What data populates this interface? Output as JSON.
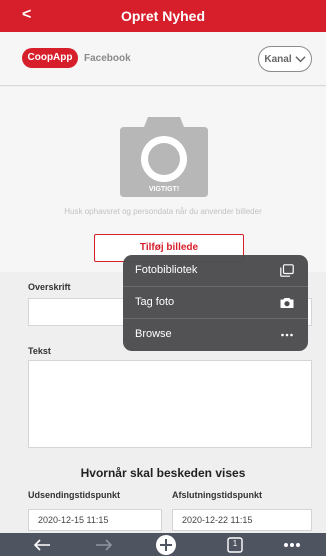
{
  "header": {
    "back_glyph": "<",
    "title": "Opret Nyhed"
  },
  "channels": {
    "active": "CoopApp",
    "other": "Facebook",
    "kanal_label": "Kanal"
  },
  "photo": {
    "watermark": "VIGTIGT!",
    "hint": "Husk ophavsret og persondata når du anvender billeder",
    "add_button": "Tilføj billede"
  },
  "form": {
    "headline_label": "Overskrift",
    "text_label": "Tekst"
  },
  "schedule": {
    "title": "Hvornår skal beskeden vises",
    "start_label": "Udsendingstidspunkt",
    "end_label": "Afslutningstidspunkt",
    "start_value": "2020-12-15 11:15",
    "end_value": "2020-12-22 11:15"
  },
  "menu": {
    "items": [
      {
        "label": "Fotobibliotek",
        "icon": "photo-library-icon"
      },
      {
        "label": "Tag foto",
        "icon": "camera-icon"
      },
      {
        "label": "Browse",
        "icon": "more-horizontal-icon"
      }
    ]
  },
  "browser": {
    "tab_count": "1"
  },
  "colors": {
    "brand": "#d71f2b",
    "toolbar": "#4f5461",
    "popup": "#4c4c4e"
  }
}
